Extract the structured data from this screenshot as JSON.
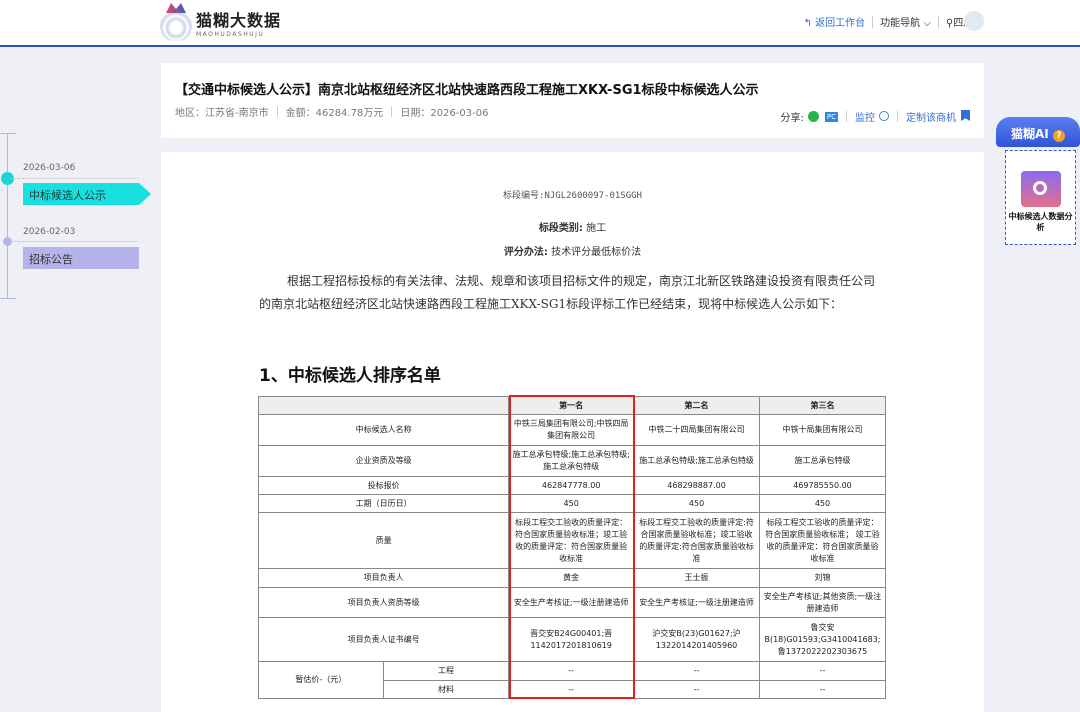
{
  "header": {
    "logo_cn": "猫糊大数据",
    "logo_en": "MAOHUDASHUJU",
    "back": "返回工作台",
    "nav": "功能导航",
    "region": "四川"
  },
  "notice": {
    "title": "【交通中标候选人公示】南京北站枢纽经济区北站快速路西段工程施工XKX-SG1标段中标候选人公示",
    "area": "地区：江苏省-南京市",
    "amount": "金额：46284.78万元",
    "date": "日期：2026-03-06",
    "share": "分享:",
    "pc": "PC",
    "monitor": "监控",
    "customize": "定制该商机"
  },
  "timeline": [
    {
      "date": "2026-03-06",
      "label": "中标候选人公示"
    },
    {
      "date": "2026-02-03",
      "label": "招标公告"
    }
  ],
  "doc": {
    "code": "标段编号:NJGL2600097-01SGGH",
    "category_label": "标段类别:",
    "category": "施工",
    "method_label": "评分办法:",
    "method": "技术评分最低标价法",
    "paragraph": "根据工程招标投标的有关法律、法规、规章和该项目招标文件的规定，南京江北新区铁路建设投资有限责任公司的南京北站枢纽经济区北站快速路西段工程施工XKX-SG1标段评标工作已经结束，现将中标候选人公示如下：",
    "heading": "1、中标候选人排序名单"
  },
  "table": {
    "headers": [
      "",
      "第一名",
      "第二名",
      "第三名"
    ],
    "rows": [
      [
        "中标候选人名称",
        "中铁三局集团有限公司;中铁四局集团有限公司",
        "中铁二十四局集团有限公司",
        "中铁十局集团有限公司"
      ],
      [
        "企业资质及等级",
        "施工总承包特级;施工总承包特级;施工总承包特级",
        "施工总承包特级;施工总承包特级",
        "施工总承包特级"
      ],
      [
        "投标报价",
        "462847778.00",
        "468298887.00",
        "469785550.00"
      ],
      [
        "工期（日历日）",
        "450",
        "450",
        "450"
      ],
      [
        "质量",
        "标段工程交工验收的质量评定：符合国家质量验收标准；竣工验收的质量评定：符合国家质量验收标准",
        "标段工程交工验收的质量评定:符合国家质量验收标准；竣工验收的质量评定:符合国家质量验收标准",
        "标段工程交工验收的质量评定：符合国家质量验收标准； 竣工验收的质量评定：符合国家质量验收标准"
      ],
      [
        "项目负责人",
        "黄金",
        "王士振",
        "刘锦"
      ],
      [
        "项目负责人资质等级",
        "安全生产考核证;一级注册建造师",
        "安全生产考核证;一级注册建造师",
        "安全生产考核证;其他资质;一级注册建造师"
      ],
      [
        "项目负责人证书编号",
        "晋交安B24G00401;晋1142017201810619",
        "沪交安B(23)G01627;沪1322014201405960",
        "鲁交安B(18)G01593;G3410041683;鲁1372022202303675"
      ]
    ],
    "provisional": {
      "label": "暂估价-（元）",
      "sub": [
        {
          "name": "工程",
          "values": [
            "--",
            "--",
            "--"
          ]
        },
        {
          "name": "材料",
          "values": [
            "--",
            "--",
            "--"
          ]
        }
      ]
    }
  },
  "ai": {
    "title": "猫糊AI",
    "help": "?",
    "card": "中标候选人数据分析"
  }
}
